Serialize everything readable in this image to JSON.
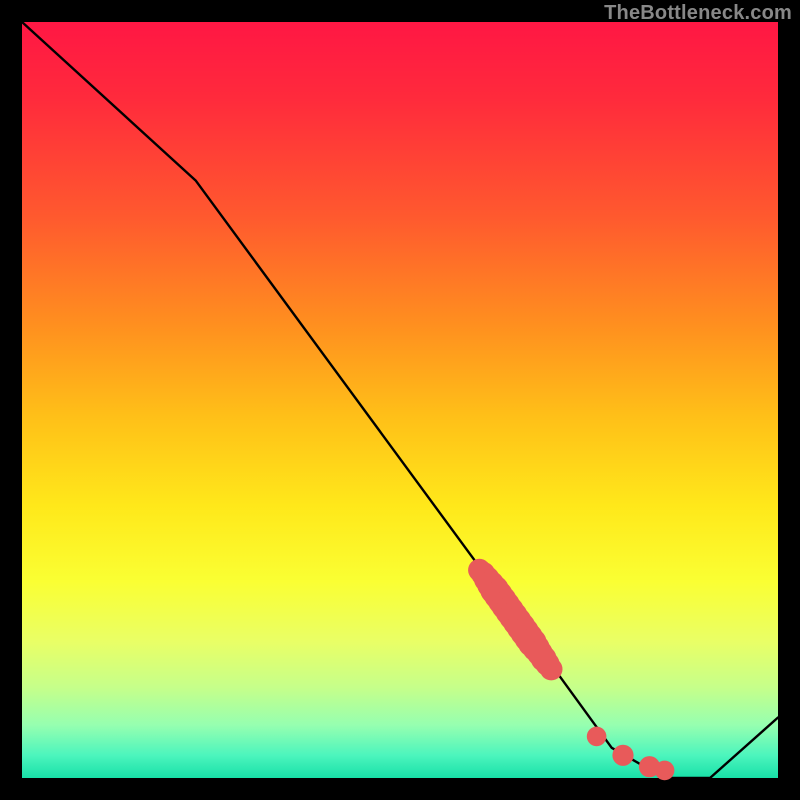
{
  "watermark": "TheBottleneck.com",
  "chart_data": {
    "type": "line",
    "title": "",
    "xlabel": "",
    "ylabel": "",
    "xlim": [
      0,
      100
    ],
    "ylim": [
      0,
      100
    ],
    "grid": false,
    "legend": false,
    "series": [
      {
        "name": "curve",
        "color": "#000000",
        "x": [
          0,
          23,
          70,
          78,
          85,
          91,
          100
        ],
        "values": [
          100,
          79,
          15,
          4,
          0,
          0,
          8
        ]
      }
    ],
    "scatter_clusters": [
      {
        "name": "cluster-stripe",
        "color": "#e85a5a",
        "shape": "circle",
        "points": [
          {
            "x": 60.5,
            "y": 27.5,
            "r": 1.5
          },
          {
            "x": 61.0,
            "y": 27.0,
            "r": 1.6
          },
          {
            "x": 61.5,
            "y": 26.3,
            "r": 1.7
          },
          {
            "x": 62.0,
            "y": 25.6,
            "r": 1.8
          },
          {
            "x": 62.5,
            "y": 24.9,
            "r": 1.9
          },
          {
            "x": 63.0,
            "y": 24.2,
            "r": 1.9
          },
          {
            "x": 63.5,
            "y": 23.5,
            "r": 1.9
          },
          {
            "x": 64.0,
            "y": 22.8,
            "r": 1.9
          },
          {
            "x": 64.5,
            "y": 22.1,
            "r": 1.9
          },
          {
            "x": 65.0,
            "y": 21.4,
            "r": 1.9
          },
          {
            "x": 65.5,
            "y": 20.7,
            "r": 1.9
          },
          {
            "x": 66.0,
            "y": 20.0,
            "r": 1.9
          },
          {
            "x": 66.5,
            "y": 19.3,
            "r": 1.9
          },
          {
            "x": 67.0,
            "y": 18.6,
            "r": 1.9
          },
          {
            "x": 67.5,
            "y": 17.9,
            "r": 1.9
          },
          {
            "x": 68.0,
            "y": 17.2,
            "r": 1.8
          },
          {
            "x": 68.5,
            "y": 16.5,
            "r": 1.7
          },
          {
            "x": 69.0,
            "y": 15.8,
            "r": 1.7
          },
          {
            "x": 69.5,
            "y": 15.1,
            "r": 1.6
          },
          {
            "x": 70.0,
            "y": 14.4,
            "r": 1.5
          }
        ]
      },
      {
        "name": "cluster-bottom-dots",
        "color": "#e85a5a",
        "shape": "circle",
        "points": [
          {
            "x": 76.0,
            "y": 5.5,
            "r": 1.3
          },
          {
            "x": 79.5,
            "y": 3.0,
            "r": 1.4
          },
          {
            "x": 83.0,
            "y": 1.5,
            "r": 1.4
          },
          {
            "x": 85.0,
            "y": 1.0,
            "r": 1.3
          }
        ]
      }
    ]
  }
}
